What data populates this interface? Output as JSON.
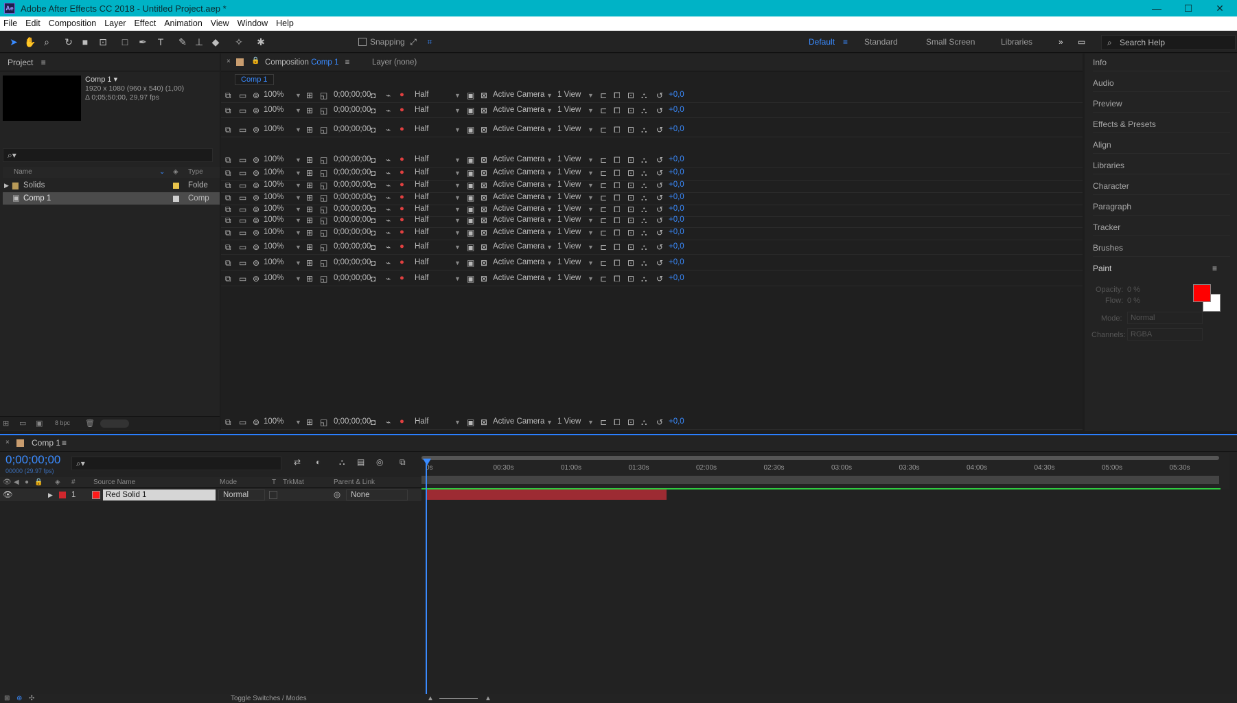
{
  "window": {
    "title": "Adobe After Effects CC 2018 - Untitled Project.aep *",
    "app_icon": "Ae"
  },
  "menu": [
    "File",
    "Edit",
    "Composition",
    "Layer",
    "Effect",
    "Animation",
    "View",
    "Window",
    "Help"
  ],
  "toolbar": {
    "snapping_label": "Snapping",
    "workspaces": [
      "Default",
      "Standard",
      "Small Screen",
      "Libraries"
    ],
    "active_workspace": "Default",
    "search_placeholder": "Search Help"
  },
  "project": {
    "panel_title": "Project",
    "comp_name": "Comp 1 ▾",
    "comp_details": "1920 x 1080  (960 x 540) (1,00)",
    "comp_duration": "Δ 0;05;50;00, 29,97 fps",
    "col_name": "Name",
    "col_type": "Type",
    "items": [
      {
        "name": "Solids",
        "type": "Folde",
        "label_color": "#e8c34b"
      },
      {
        "name": "Comp 1",
        "type": "Comp",
        "label_color": "#cfcfcf"
      }
    ],
    "bpc": "8 bpc"
  },
  "composition": {
    "tab_label": "Composition",
    "tab_comp": "Comp 1",
    "layer_tab": "Layer (none)",
    "breadcrumb": "Comp 1",
    "viewer": {
      "zoom": "100%",
      "timecode": "0;00;00;00",
      "resolution": "Half",
      "camera": "Active Camera",
      "views": "1 View",
      "exposure": "+0,0"
    }
  },
  "right_panels": [
    "Info",
    "Audio",
    "Preview",
    "Effects & Presets",
    "Align",
    "Libraries",
    "Character",
    "Paragraph",
    "Tracker",
    "Brushes"
  ],
  "paint": {
    "title": "Paint",
    "opacity_label": "Opacity:",
    "opacity": "0 %",
    "flow_label": "Flow:",
    "flow": "0 %",
    "mode_label": "Mode:",
    "mode": "Normal",
    "channels_label": "Channels:",
    "channels": "RGBA",
    "foreground_color": "#ff0000",
    "background_color": "#ffffff"
  },
  "timeline": {
    "comp_tab": "Comp 1",
    "timecode": "0;00;00;00",
    "fps": "00000 (29.97 fps)",
    "columns": {
      "source": "Source Name",
      "mode": "Mode",
      "t": "T",
      "trkmat": "TrkMat",
      "parent": "Parent & Link"
    },
    "layer": {
      "index": "1",
      "name": "Red Solid 1",
      "mode": "Normal",
      "parent": "None",
      "color": "#d0272d"
    },
    "ruler": [
      "0s",
      "00:30s",
      "01:00s",
      "01:30s",
      "02:00s",
      "02:30s",
      "03:00s",
      "03:30s",
      "04:00s",
      "04:30s",
      "05:00s",
      "05:30s"
    ],
    "footer_toggle": "Toggle Switches / Modes"
  },
  "colors": {
    "accent": "#2a7fff",
    "title_bar": "#00b3c6",
    "layer_bar": "#9d2b33"
  }
}
